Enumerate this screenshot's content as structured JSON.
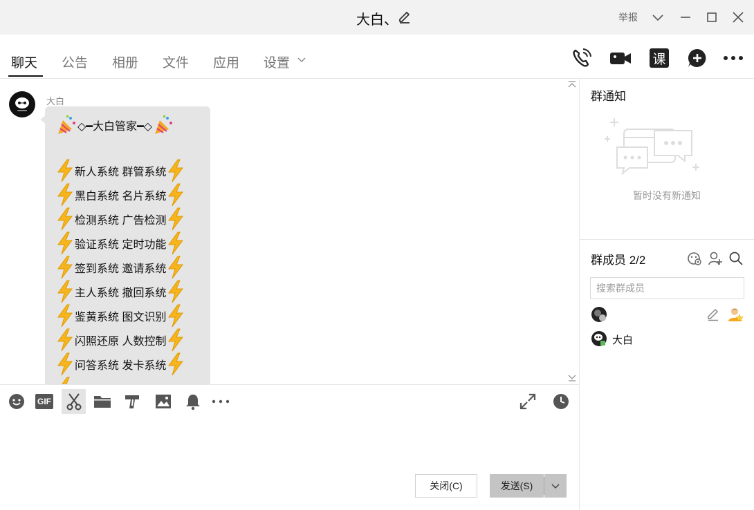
{
  "window": {
    "title": "大白、",
    "report_label": "举报"
  },
  "tabs": [
    {
      "label": "聊天"
    },
    {
      "label": "公告"
    },
    {
      "label": "相册"
    },
    {
      "label": "文件"
    },
    {
      "label": "应用"
    },
    {
      "label": "设置"
    }
  ],
  "top_actions": {
    "course_label": "课"
  },
  "message": {
    "sender": "大白",
    "title": "◇━大白管家━◇",
    "lines": [
      "新人系统 群管系统",
      "黑白系统 名片系统",
      "检测系统 广告检测",
      "验证系统 定时功能",
      "签到系统 邀请系统",
      "主人系统 撤回系统",
      "鉴黄系统 图文识别",
      "闪照还原 人数控制",
      "问答系统 发卡系统"
    ]
  },
  "toolbar": {
    "gif_label": "GIF"
  },
  "buttons": {
    "close": "关闭(C)",
    "send": "发送(S)"
  },
  "notice": {
    "title": "群通知",
    "empty": "暂时没有新通知"
  },
  "members": {
    "title": "群成员 2/2",
    "search_placeholder": "搜索群成员",
    "list": [
      {
        "name": ""
      },
      {
        "name": "大白"
      }
    ]
  },
  "colors": {
    "titlebar_bg": "#f2f2f2",
    "bubble_bg": "#e5e5e5",
    "send_bg": "#c4c4c4",
    "bolt": "#f6b51e"
  }
}
